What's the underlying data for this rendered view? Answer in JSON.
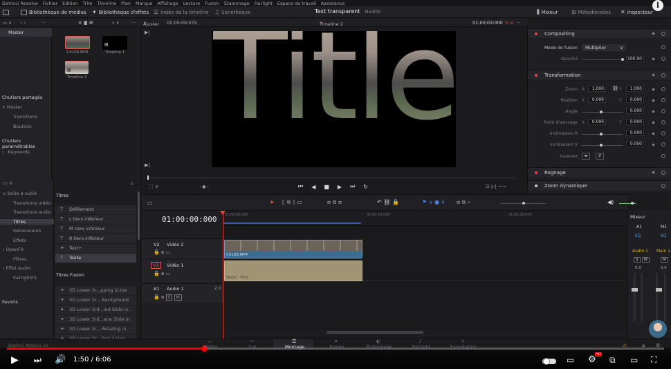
{
  "menu": [
    "DaVinci Resolve",
    "Fichier",
    "Edition",
    "Trim",
    "Timeline",
    "Plan",
    "Marque",
    "Affichage",
    "Lecture",
    "Fusion",
    "Étalonnage",
    "Fairlight",
    "Espace de travail",
    "Assistance"
  ],
  "toolbar": {
    "media_pool": "Bibliothèque de médias",
    "effects_library": "Bibliothèque d'effets",
    "edit_index": "Index de la timeline",
    "sound_library": "Sonothèque",
    "project_title": "Text transparent",
    "project_status": "Modifié",
    "mixer": "Mixeur",
    "metadata": "Métadonnées",
    "inspector": "Inspecteur"
  },
  "subbar": {
    "zoom": "Ajuster",
    "source_tc": "00:00:09:079",
    "timeline_name": "Timeline 2",
    "viewer_tc": "01:00:03:000"
  },
  "left_panel": {
    "master": "Master",
    "smart_bins_shared": "Chutiers partagés",
    "shared_items": [
      "Master",
      "Transitions",
      "Boutons"
    ],
    "smart_bins": "Chutiers paramétrables",
    "smart_items": [
      "Keywords"
    ]
  },
  "media_pool": {
    "clips": [
      {
        "label": "C0109.MP4",
        "kind": "video"
      },
      {
        "label": "Timeline 1",
        "kind": "timeline"
      },
      {
        "label": "Timeline 2",
        "kind": "timeline"
      }
    ]
  },
  "viewer": {
    "title_text": "Title"
  },
  "inspector": {
    "compositing": "Compositing",
    "blend_mode_label": "Mode de fusion",
    "blend_mode_value": "Multiplier",
    "opacity_label": "Opacité",
    "opacity_value": "100.00",
    "transform": "Transformation",
    "zoom_label": "Zoom",
    "zoom_x": "1.000",
    "zoom_y": "1.000",
    "position_label": "Position",
    "position_x": "0.000",
    "position_y": "0.000",
    "rotation_label": "Angle",
    "rotation_value": "0.000",
    "anchor_label": "Point d'ancrage",
    "anchor_x": "0.000",
    "anchor_y": "0.000",
    "pitch_label": "Inclinaison H",
    "pitch_value": "0.000",
    "yaw_label": "Inclinaison V",
    "yaw_value": "0.000",
    "flip_label": "Inverser",
    "crop": "Rognage",
    "dynamic_zoom": "Zoom dynamique",
    "axis_x": "X",
    "axis_y": "Y"
  },
  "effects": {
    "nav": [
      {
        "label": "Boîte à outils",
        "level": 0
      },
      {
        "label": "Transitions vidéo",
        "level": 1
      },
      {
        "label": "Transitions audio",
        "level": 1
      },
      {
        "label": "Titres",
        "level": 1,
        "selected": true
      },
      {
        "label": "Générateurs",
        "level": 1
      },
      {
        "label": "Effets",
        "level": 1
      },
      {
        "label": "OpenFX",
        "level": 0
      },
      {
        "label": "Filtres",
        "level": 1
      },
      {
        "label": "Effet audio",
        "level": 0
      },
      {
        "label": "FairlightFX",
        "level": 1
      }
    ],
    "favorites": "Favoris",
    "titles_header": "Titres",
    "titles": [
      "Défilement",
      "L tiers inférieur",
      "M tiers inférieur",
      "R tiers inférieur",
      "Text+",
      "Texte"
    ],
    "fusion_header": "Titres Fusion",
    "fusion_titles": [
      "3D Lower 3r...pping 2Line",
      "3D Lower 3r... Background",
      "3D Lower 3rd...ind Slide in",
      "3D Lower 3rd...ane Slide in",
      "3D Lower 3r... Rotating in",
      "3D Lower 3r... line 2 Line"
    ]
  },
  "timeline": {
    "timecode": "01:00:00:000",
    "ruler": [
      "01:00:00:000",
      "01:00:10:000",
      "01:00:20:000"
    ],
    "tracks": [
      {
        "id": "V2",
        "name": "Vidéo 2"
      },
      {
        "id": "V1",
        "name": "Vidéo 1"
      },
      {
        "id": "A1",
        "name": "Audio 1",
        "channels": "2.0"
      }
    ],
    "clip_video": "C0109.MP4",
    "clip_title": "Texte - Titre"
  },
  "mixer": {
    "title": "Mixeur",
    "ch_a1": "A1",
    "ch_m1": "M1",
    "eq": "EQ",
    "audio1": "Audio 1",
    "main1": "Main 1",
    "btn_s": "S",
    "btn_m": "M",
    "level": "0.0"
  },
  "pages": [
    {
      "label": "Média"
    },
    {
      "label": "Cut"
    },
    {
      "label": "Montage",
      "active": true
    },
    {
      "label": "Fusion"
    },
    {
      "label": "Étalonnage"
    },
    {
      "label": "Fairlight"
    },
    {
      "label": "Exportation"
    }
  ],
  "app_brand": "DaVinci Resolve 16",
  "youtube": {
    "time": "1:50 / 6:06",
    "progress": 0.3,
    "accent": "#ff0000",
    "info": "i"
  }
}
